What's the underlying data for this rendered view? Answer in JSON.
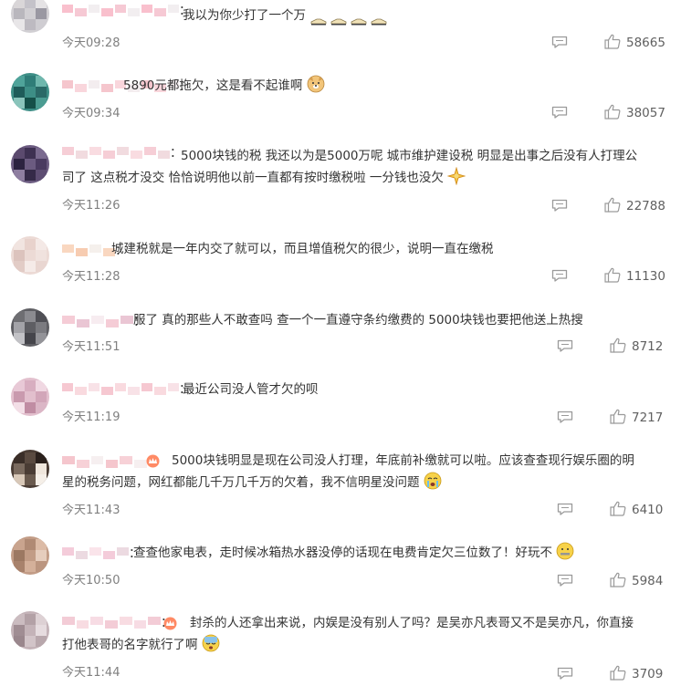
{
  "comments": [
    {
      "text": "我以为你少打了一个万",
      "time": "今天09:28",
      "likes": "58665",
      "emoji": [
        "shoe-icon",
        "shoe-icon",
        "shoe-icon",
        "shoe-icon"
      ],
      "avatar_colors": [
        "#d9d6d8",
        "#c4c2c9",
        "#e5e3e5",
        "#b9b7bd",
        "#d1cfd3",
        "#9a98a2",
        "#e8e6e8",
        "#bdbac1",
        "#cfcdd2"
      ],
      "name_colors": [
        "#f8b9c8",
        "#f5c3cf",
        "#e8e0e3"
      ]
    },
    {
      "text": "5890元都拖欠，这是看不起谁啊",
      "time": "今天09:34",
      "likes": "38057",
      "emoji": [
        "doge-icon"
      ],
      "avatar_colors": [
        "#4fa39a",
        "#2f7d78",
        "#6fb7ad",
        "#1f5c5a",
        "#3d8e86",
        "#2a6967",
        "#8ac4bb",
        "#155049",
        "#4b9c92"
      ],
      "name_colors": [
        "#f4c0c8",
        "#f8d2d8",
        "#eadfe2"
      ]
    },
    {
      "text_line1": "5000块钱的税 我还以为是5000万呢 城市维护建设税 明显是出事之后没有人打理公",
      "text_line2": "司了 这点税才没交 恰恰说明他以前一直都有按时缴税啦 一分钱也没欠",
      "time": "今天11:26",
      "likes": "22788",
      "emoji": [
        "gold-sparkle-icon"
      ],
      "avatar_colors": [
        "#5b4a6e",
        "#3e3152",
        "#7a6a8f",
        "#2c2340",
        "#6b5b80",
        "#4a3b60",
        "#8e7ea0",
        "#352a48",
        "#5d4d72"
      ],
      "name_colors": [
        "#f5c9d2",
        "#f0d7dc",
        "#f4bfc9"
      ]
    },
    {
      "text": "城建税就是一年内交了就可以，而且增值税欠的很少，说明一直在缴税",
      "time": "今天11:28",
      "likes": "11130",
      "emoji": [],
      "avatar_colors": [
        "#f1e4e0",
        "#e8d2cc",
        "#f4e9e6",
        "#dcc3bd",
        "#ecdad5",
        "#f0e2de",
        "#e2ccc6",
        "#f5ebe8",
        "#e9d6d1"
      ],
      "name_colors": [
        "#f8d3b9",
        "#f6c7a8",
        "#ede4dd"
      ]
    },
    {
      "text": "服了 真的那些人不敢查吗 查一个一直遵守条约缴费的 5000块钱也要把他送上热搜",
      "time": "今天11:51",
      "likes": "8712",
      "emoji": [],
      "avatar_colors": [
        "#6e6e72",
        "#8b8b90",
        "#4f4f55",
        "#a3a3a8",
        "#5e5e63",
        "#7b7b80",
        "#c2c2c6",
        "#45454b",
        "#939398"
      ],
      "name_colors": [
        "#f4c6d2",
        "#e8c0cf",
        "#f0dde4"
      ]
    },
    {
      "text": "最近公司没人管才欠的呗",
      "time": "今天11:19",
      "likes": "7217",
      "emoji": [],
      "avatar_colors": [
        "#e8c9d6",
        "#d8aec0",
        "#f0d8e2",
        "#c99aae",
        "#e2bfcd",
        "#d2a6b9",
        "#f3dfe7",
        "#c08da3",
        "#dbb6c6"
      ],
      "name_colors": [
        "#f5c2cc",
        "#f8d6dc",
        "#f2cbd4"
      ]
    },
    {
      "text_line1": "5000块钱明显是现在公司没人打理，年底前补缴就可以啦。应该查查现行娱乐圈的明",
      "text_line2": "星的税务问题，网红都能几千万几千万的欠着，我不信明星没问题",
      "time": "今天11:43",
      "likes": "6410",
      "emoji": [
        "crying-face-icon"
      ],
      "avatar_colors": [
        "#3a2e28",
        "#5a4a40",
        "#2a201c",
        "#7a6a5e",
        "#4a3c34",
        "#efe6dc",
        "#d8c8b8",
        "#6a5a4e",
        "#f5efe8"
      ],
      "name_colors": [
        "#f4c0c8",
        "#f6ccd3",
        "#efe1e4"
      ]
    },
    {
      "text": "查查他家电表，走时候冰箱热水器没停的话现在电费肯定欠三位数了！好玩不",
      "time": "今天10:50",
      "likes": "5984",
      "emoji": [
        "zipper-face-icon"
      ],
      "avatar_colors": [
        "#c9a48e",
        "#b08a74",
        "#dcbba6",
        "#9c7862",
        "#c29c86",
        "#e6cdbd",
        "#a8826c",
        "#d4b09a",
        "#bb957f"
      ],
      "name_colors": [
        "#f3c7d6",
        "#ead6de",
        "#f5cdd9"
      ]
    },
    {
      "text_line1": "封杀的人还拿出来说，内娱是没有别人了吗？是吴亦凡表哥又不是吴亦凡，你直接",
      "text_line2": "打他表哥的名字就行了啊",
      "time": "今天11:44",
      "likes": "3709",
      "emoji": [
        "cold-sweat-icon"
      ],
      "avatar_colors": [
        "#cbbcc0",
        "#b3a1a6",
        "#ddd1d4",
        "#a08d93",
        "#c4b3b8",
        "#e6dcdf",
        "#9a878d",
        "#d2c4c8",
        "#b8a7ac"
      ],
      "name_colors": [
        "#f2c6d2",
        "#f7d8df",
        "#f0c0cd"
      ]
    }
  ],
  "icons": {
    "reply": "comment-icon",
    "like": "thumbs-up-icon"
  },
  "colors": {
    "text": "#333333",
    "meta": "#808080",
    "icon": "#9a9a9a"
  }
}
